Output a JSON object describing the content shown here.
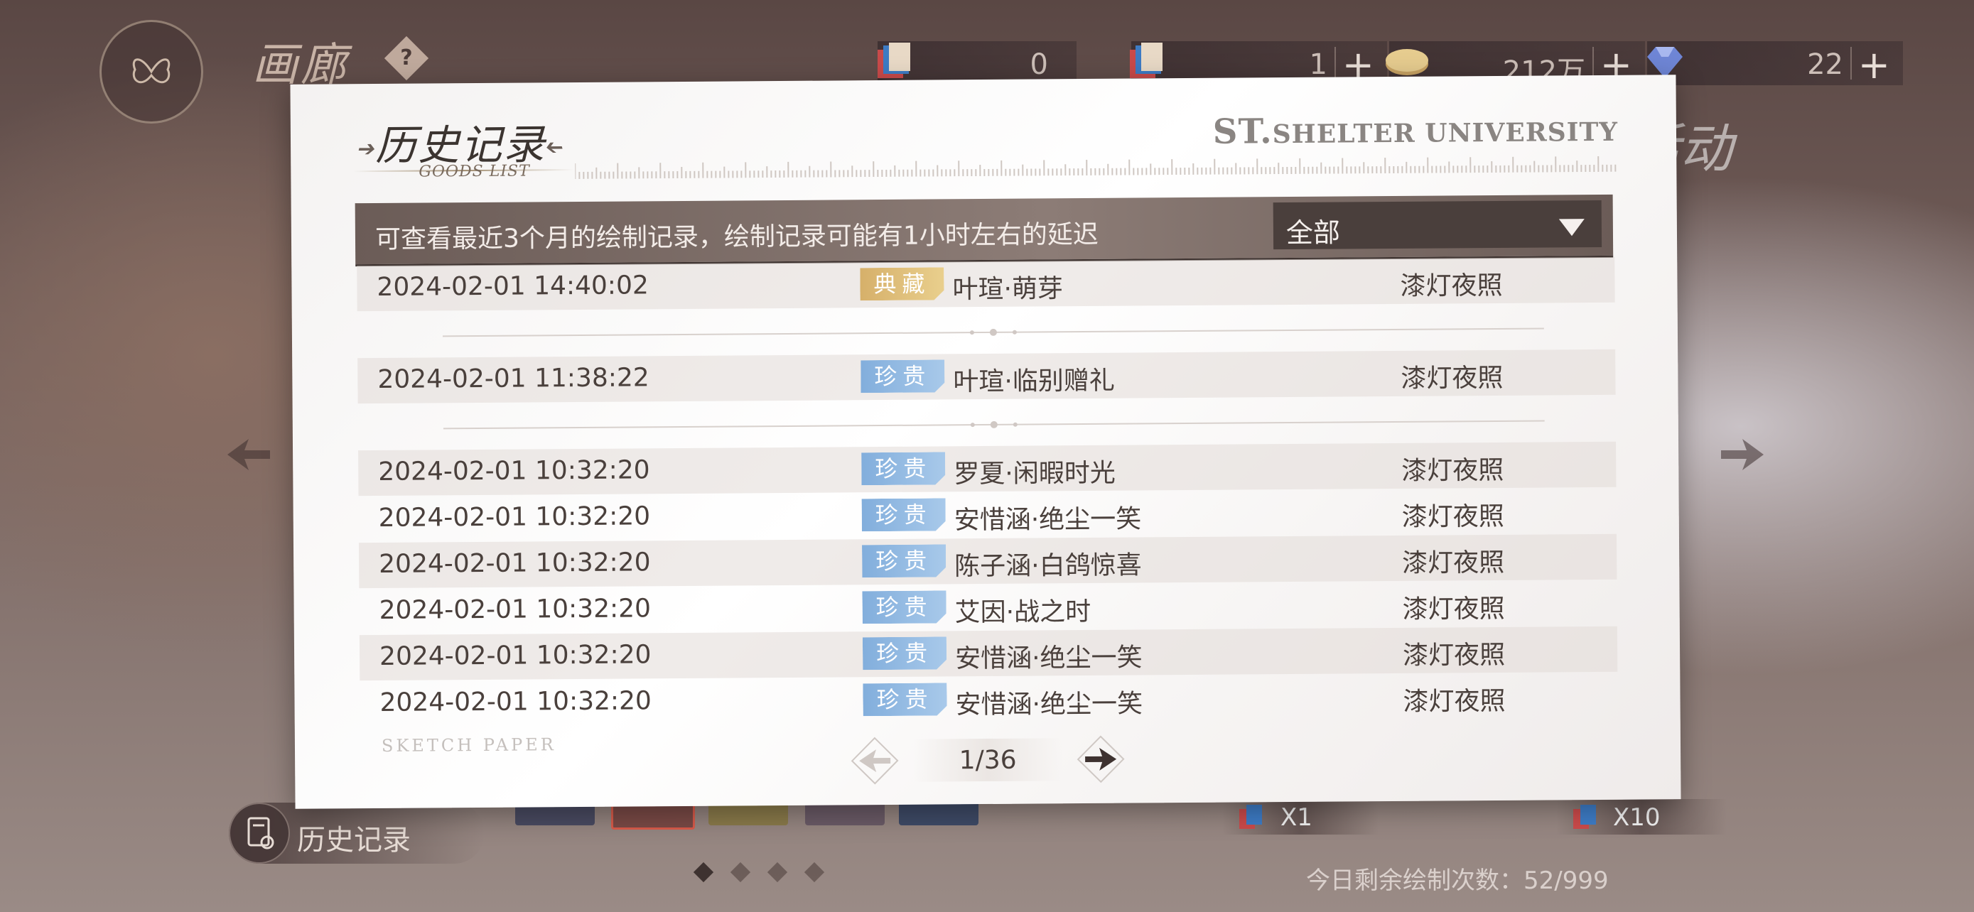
{
  "header": {
    "title": "画廊",
    "help_symbol": "?",
    "currencies": [
      {
        "name": "draw-ticket-single",
        "value": "0",
        "plus": false
      },
      {
        "name": "draw-ticket-multi",
        "value": "1",
        "plus": true
      },
      {
        "name": "coin",
        "value": "212万",
        "plus": true
      },
      {
        "name": "diamond",
        "value": "22",
        "plus": true
      }
    ]
  },
  "background": {
    "activity_label": "活动"
  },
  "modal": {
    "title": "历史记录",
    "subtitle": "GOODS LIST",
    "brand_prefix": "ST.",
    "brand": "SHELTER UNIVERSITY",
    "note": "可查看最近3个月的绘制记录，绘制记录可能有1小时左右的延迟",
    "filter_value": "全部",
    "rows": [
      {
        "date": "2024-02-01  14:40:02",
        "rarity": "典藏",
        "name": "叶瑄·萌芽",
        "pool": "漆灯夜照"
      },
      {
        "date": "2024-02-01  11:38:22",
        "rarity": "珍贵",
        "name": "叶瑄·临别赠礼",
        "pool": "漆灯夜照"
      },
      {
        "date": "2024-02-01  10:32:20",
        "rarity": "珍贵",
        "name": "罗夏·闲暇时光",
        "pool": "漆灯夜照"
      },
      {
        "date": "2024-02-01  10:32:20",
        "rarity": "珍贵",
        "name": "安惜涵·绝尘一笑",
        "pool": "漆灯夜照"
      },
      {
        "date": "2024-02-01  10:32:20",
        "rarity": "珍贵",
        "name": "陈子涵·白鸽惊喜",
        "pool": "漆灯夜照"
      },
      {
        "date": "2024-02-01  10:32:20",
        "rarity": "珍贵",
        "name": "艾因·战之时",
        "pool": "漆灯夜照"
      },
      {
        "date": "2024-02-01  10:32:20",
        "rarity": "珍贵",
        "name": "安惜涵·绝尘一笑",
        "pool": "漆灯夜照"
      },
      {
        "date": "2024-02-01  10:32:20",
        "rarity": "珍贵",
        "name": "安惜涵·绝尘一笑",
        "pool": "漆灯夜照"
      }
    ],
    "watermark": "SKETCH PAPER",
    "page": "1/36"
  },
  "footer": {
    "history_label": "历史记录",
    "draw_single_label": "X1",
    "draw_multi_label": "X10",
    "remaining": "今日剩余绘制次数：52/999"
  },
  "colors": {
    "rarity_gold": "#d6b06a",
    "rarity_blue": "#82aedc",
    "infobar": "#7a6b66"
  }
}
